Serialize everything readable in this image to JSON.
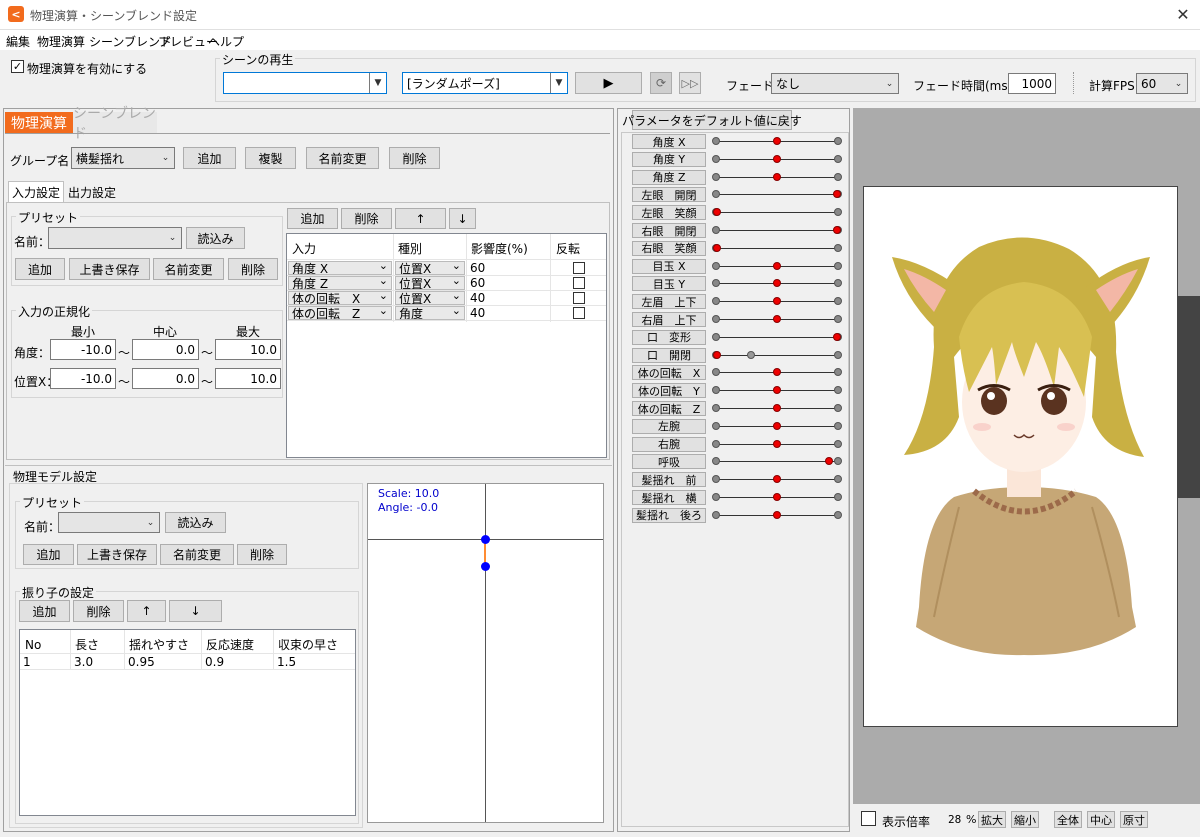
{
  "title": "物理演算・シーンブレンド設定",
  "menu": [
    "編集",
    "物理演算",
    "シーンブレンド",
    "プレビュー",
    "ヘルプ"
  ],
  "enable_physics": {
    "label": "物理演算を有効にする",
    "checked": true
  },
  "scene": {
    "group_label": "シーンの再生",
    "scene_select": "",
    "pose_select": "[ランダムポーズ]",
    "fade_label": "フェード：",
    "fade_value": "なし",
    "fade_time_label": "フェード時間(ms)：",
    "fade_time": "1000",
    "fps_label": "計算FPS",
    "fps_value": "60"
  },
  "tabs": {
    "physics": "物理演算",
    "blend": "シーンブレンド"
  },
  "group": {
    "label": "グループ名：",
    "value": "横髪揺れ",
    "add": "追加",
    "copy": "複製",
    "rename": "名前変更",
    "delete": "削除"
  },
  "io_tabs": {
    "input": "入力設定",
    "output": "出力設定"
  },
  "preset": {
    "title": "プリセット",
    "name_label": "名前：",
    "load": "読込み",
    "add": "追加",
    "overwrite": "上書き保存",
    "rename": "名前変更",
    "delete": "削除"
  },
  "normalize": {
    "title": "入力の正規化",
    "headers": [
      "最小",
      "中心",
      "最大"
    ],
    "rows": [
      {
        "label": "角度：",
        "min": "-10.0",
        "center": "0.0",
        "max": "10.0"
      },
      {
        "label": "位置X：",
        "min": "-10.0",
        "center": "0.0",
        "max": "10.0"
      }
    ],
    "tilde": "～"
  },
  "input_table": {
    "buttons": {
      "add": "追加",
      "delete": "削除",
      "up": "↑",
      "down": "↓"
    },
    "headers": [
      "入力",
      "種別",
      "影響度(%)",
      "反転"
    ],
    "rows": [
      {
        "input": "角度 X",
        "kind": "位置X",
        "effect": "60",
        "invert": false
      },
      {
        "input": "角度 Z",
        "kind": "位置X",
        "effect": "60",
        "invert": false
      },
      {
        "input": "体の回転　X",
        "kind": "位置X",
        "effect": "40",
        "invert": false
      },
      {
        "input": "体の回転　Z",
        "kind": "角度",
        "effect": "40",
        "invert": false
      }
    ]
  },
  "model": {
    "title": "物理モデル設定",
    "pendulum_title": "振り子の設定",
    "headers": [
      "No",
      "長さ",
      "揺れやすさ",
      "反応速度",
      "収束の早さ"
    ],
    "rows": [
      {
        "no": "1",
        "length": "3.0",
        "sway": "0.95",
        "speed": "0.9",
        "converge": "1.5"
      }
    ],
    "scale_text": "Scale: 10.0",
    "angle_text": "Angle: -0.0"
  },
  "params": {
    "reset_label": "パラメータをデフォルト値に戻す",
    "items": [
      {
        "label": "角度 X",
        "value": 0.5
      },
      {
        "label": "角度 Y",
        "value": 0.5
      },
      {
        "label": "角度 Z",
        "value": 0.5
      },
      {
        "label": "左眼　開閉",
        "value": 1.0
      },
      {
        "label": "左眼　笑顔",
        "value": 0.0
      },
      {
        "label": "右眼　開閉",
        "value": 1.0
      },
      {
        "label": "右眼　笑顔",
        "value": 0.0
      },
      {
        "label": "目玉 X",
        "value": 0.5
      },
      {
        "label": "目玉 Y",
        "value": 0.5
      },
      {
        "label": "左眉　上下",
        "value": 0.5
      },
      {
        "label": "右眉　上下",
        "value": 0.5
      },
      {
        "label": "口　変形",
        "value": 1.0
      },
      {
        "label": "口　開閉",
        "value": 0.0
      },
      {
        "label": "体の回転　X",
        "value": 0.5
      },
      {
        "label": "体の回転　Y",
        "value": 0.5
      },
      {
        "label": "体の回転　Z",
        "value": 0.5
      },
      {
        "label": "左腕",
        "value": 0.5
      },
      {
        "label": "右腕",
        "value": 0.5
      },
      {
        "label": "呼吸",
        "value": 0.93
      },
      {
        "label": "髪揺れ　前",
        "value": 0.5
      },
      {
        "label": "髪揺れ　横",
        "value": 0.5
      },
      {
        "label": "髪揺れ　後ろ",
        "value": 0.5
      }
    ]
  },
  "zoom": {
    "label": "表示倍率",
    "value": "28",
    "unit": "%",
    "zoom_in": "拡大",
    "zoom_out": "縮小",
    "all": "全体",
    "center": "中心",
    "original": "原寸"
  },
  "colors": {
    "accent": "#f26b1d",
    "slider_red": "#e00000",
    "pendulum_blue": "#0000ff",
    "pendulum_orange": "#ff8c33"
  }
}
